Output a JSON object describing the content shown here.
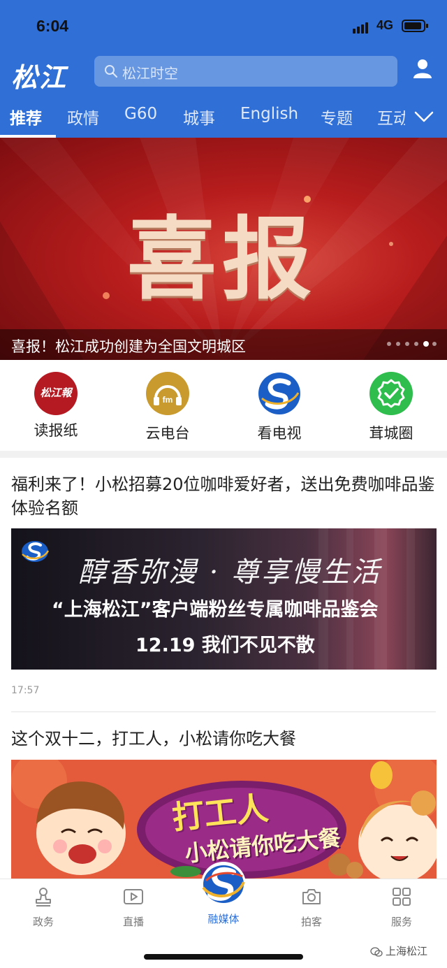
{
  "status_bar": {
    "time": "6:04",
    "network": "4G"
  },
  "header": {
    "logo": "松江",
    "search_placeholder": "松江时空",
    "tabs": [
      "推荐",
      "政情",
      "G60",
      "城事",
      "English",
      "专题",
      "互动"
    ],
    "active_tab": "推荐"
  },
  "banner": {
    "headline": "喜报",
    "caption": "喜报！松江成功创建为全国文明城区",
    "slide_count": 6,
    "active_slide": 4
  },
  "quick_links": [
    {
      "label": "读报纸",
      "icon": "newspaper-icon",
      "badge": "松江報"
    },
    {
      "label": "云电台",
      "icon": "radio-icon",
      "badge": "fm"
    },
    {
      "label": "看电视",
      "icon": "tv-icon"
    },
    {
      "label": "茸城圈",
      "icon": "verified-circle-icon"
    }
  ],
  "articles": [
    {
      "title": "福利来了！小松招募20位咖啡爱好者，送出免费咖啡品鉴体验名额",
      "image_lines": [
        "醇香弥漫 · 尊享慢生活",
        "“上海松江”客户端粉丝专属咖啡品鉴会",
        "12.19 我们不见不散"
      ],
      "time": "17:57"
    },
    {
      "title": "这个双十二，打工人，小松请你吃大餐",
      "image_lines": [
        "打工人",
        "小松请你吃大餐"
      ]
    }
  ],
  "bottom_nav": [
    {
      "label": "政务",
      "icon": "stamp-icon"
    },
    {
      "label": "直播",
      "icon": "play-icon"
    },
    {
      "label": "融媒体",
      "icon": "app-logo-icon",
      "active": true
    },
    {
      "label": "拍客",
      "icon": "camera-icon"
    },
    {
      "label": "服务",
      "icon": "grid-icon"
    }
  ],
  "watermark": "上海松江",
  "colors": {
    "brand_blue": "#2f6fd6",
    "banner_red": "#b81d1d"
  }
}
